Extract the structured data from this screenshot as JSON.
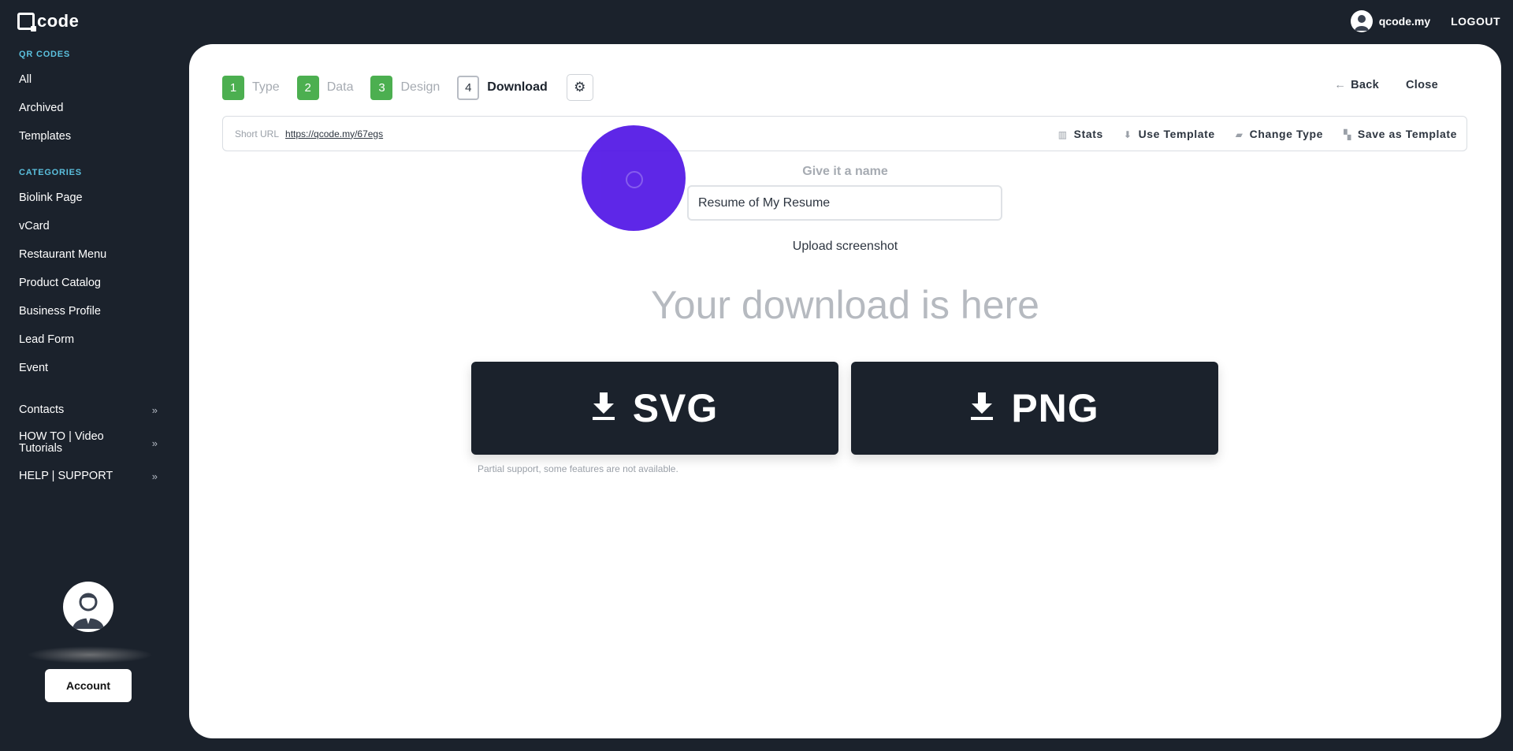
{
  "brand": {
    "logo_text": "code"
  },
  "topbar": {
    "user_name": "qcode.my",
    "logout_label": "LOGOUT"
  },
  "sidebar": {
    "qr_section": "QR CODES",
    "qr_items": [
      {
        "label": "All"
      },
      {
        "label": "Archived"
      },
      {
        "label": "Templates"
      }
    ],
    "categories_section": "CATEGORIES",
    "category_items": [
      {
        "label": "Biolink Page"
      },
      {
        "label": "vCard"
      },
      {
        "label": "Restaurant Menu"
      },
      {
        "label": "Product Catalog"
      },
      {
        "label": "Business Profile"
      },
      {
        "label": "Lead Form"
      },
      {
        "label": "Event"
      }
    ],
    "groups": [
      {
        "label": "Contacts",
        "icon": "double-chevron-right-icon"
      },
      {
        "label": "HOW TO | Video Tutorials",
        "icon": "double-chevron-right-icon"
      },
      {
        "label": "HELP | SUPPORT",
        "icon": "double-chevron-right-icon"
      }
    ],
    "account_label": "Account"
  },
  "steps": [
    {
      "num": "1",
      "label": "Type"
    },
    {
      "num": "2",
      "label": "Data"
    },
    {
      "num": "3",
      "label": "Design"
    },
    {
      "num": "4",
      "label": "Download"
    }
  ],
  "actions": {
    "back_label": "Back",
    "close_label": "Close"
  },
  "url_bar": {
    "label": "Short URL",
    "url": "https://qcode.my/67egs",
    "stats_label": "Stats",
    "use_template_label": "Use Template",
    "change_type_label": "Change Type",
    "save_template_label": "Save as Template"
  },
  "name_section": {
    "title": "Give it a name",
    "value": "Resume of My Resume",
    "upload_label": "Upload screenshot"
  },
  "download": {
    "title": "Your download is here",
    "svg_label": "SVG",
    "png_label": "PNG",
    "note": "Partial support, some features are not available."
  },
  "colors": {
    "step_done": "#4caf50",
    "dark": "#1b222c",
    "accent_cyan": "#5bc0de",
    "cursor": "#5217e6"
  }
}
